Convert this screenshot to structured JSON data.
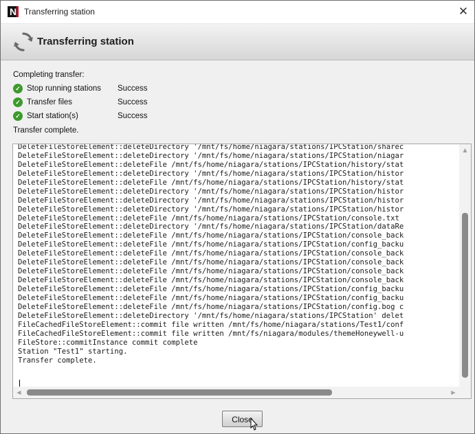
{
  "window": {
    "title": "Transferring station",
    "app_icon": "niagara-n-icon",
    "close_glyph": "✕"
  },
  "header": {
    "title": "Transferring station",
    "icon": "refresh-icon"
  },
  "progress": {
    "completing_label": "Completing transfer:",
    "steps": [
      {
        "label": "Stop running stations",
        "status": "Success"
      },
      {
        "label": "Transfer files",
        "status": "Success"
      },
      {
        "label": "Start station(s)",
        "status": "Success"
      }
    ],
    "complete_label": "Transfer complete."
  },
  "log": {
    "lines": [
      "DeleteFileStoreElement::deleteDirectory '/mnt/fs/home/niagara/stations/IPCStation/sharec",
      "DeleteFileStoreElement::deleteDirectory '/mnt/fs/home/niagara/stations/IPCStation/niagar",
      "DeleteFileStoreElement::deleteFile /mnt/fs/home/niagara/stations/IPCStation/history/stat",
      "DeleteFileStoreElement::deleteDirectory '/mnt/fs/home/niagara/stations/IPCStation/histor",
      "DeleteFileStoreElement::deleteFile /mnt/fs/home/niagara/stations/IPCStation/history/stat",
      "DeleteFileStoreElement::deleteDirectory '/mnt/fs/home/niagara/stations/IPCStation/histor",
      "DeleteFileStoreElement::deleteDirectory '/mnt/fs/home/niagara/stations/IPCStation/histor",
      "DeleteFileStoreElement::deleteDirectory '/mnt/fs/home/niagara/stations/IPCStation/histor",
      "DeleteFileStoreElement::deleteFile /mnt/fs/home/niagara/stations/IPCStation/console.txt",
      "DeleteFileStoreElement::deleteDirectory '/mnt/fs/home/niagara/stations/IPCStation/dataRe",
      "DeleteFileStoreElement::deleteFile /mnt/fs/home/niagara/stations/IPCStation/console_back",
      "DeleteFileStoreElement::deleteFile /mnt/fs/home/niagara/stations/IPCStation/config_backu",
      "DeleteFileStoreElement::deleteFile /mnt/fs/home/niagara/stations/IPCStation/console_back",
      "DeleteFileStoreElement::deleteFile /mnt/fs/home/niagara/stations/IPCStation/console_back",
      "DeleteFileStoreElement::deleteFile /mnt/fs/home/niagara/stations/IPCStation/console_back",
      "DeleteFileStoreElement::deleteFile /mnt/fs/home/niagara/stations/IPCStation/console_back",
      "DeleteFileStoreElement::deleteFile /mnt/fs/home/niagara/stations/IPCStation/config_backu",
      "DeleteFileStoreElement::deleteFile /mnt/fs/home/niagara/stations/IPCStation/config_backu",
      "DeleteFileStoreElement::deleteFile /mnt/fs/home/niagara/stations/IPCStation/config.bog c",
      "DeleteFileStoreElement::deleteDirectory '/mnt/fs/home/niagara/stations/IPCStation' delet",
      "FileCachedFileStoreElement::commit file written /mnt/fs/home/niagara/stations/Test1/conf",
      "FileCachedFileStoreElement::commit file written /mnt/fs/niagara/modules/themeHoneywell-u",
      "FileStore::commitInstance commit complete",
      "Station \"Test1\" starting.",
      "Transfer complete."
    ]
  },
  "buttons": {
    "close_label": "Close"
  },
  "colors": {
    "success_green": "#3d9a2c",
    "header_gradient_top": "#f3f3f3",
    "header_gradient_bottom": "#d6d6d6"
  }
}
